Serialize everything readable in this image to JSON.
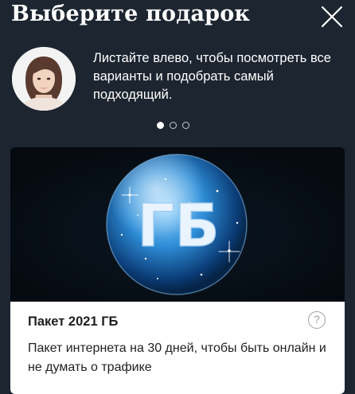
{
  "header": {
    "title": "Выберите подарок",
    "close_icon": "close-icon"
  },
  "intro": {
    "avatar": "assistant-avatar",
    "text": "Листайте влево, чтобы посмотреть все варианты и подобрать самый подходящий."
  },
  "carousel": {
    "pages": 3,
    "active_index": 0
  },
  "card": {
    "image_text": "ГБ",
    "title": "Пакет 2021 ГБ",
    "help_icon": "question-icon",
    "help_glyph": "?",
    "description": "Пакет интернета на 30 дней, чтобы быть онлайн и не думать о трафике"
  },
  "colors": {
    "background": "#1c2530",
    "card_bg": "#0c1218",
    "accent_blue": "#2f8fd8"
  }
}
